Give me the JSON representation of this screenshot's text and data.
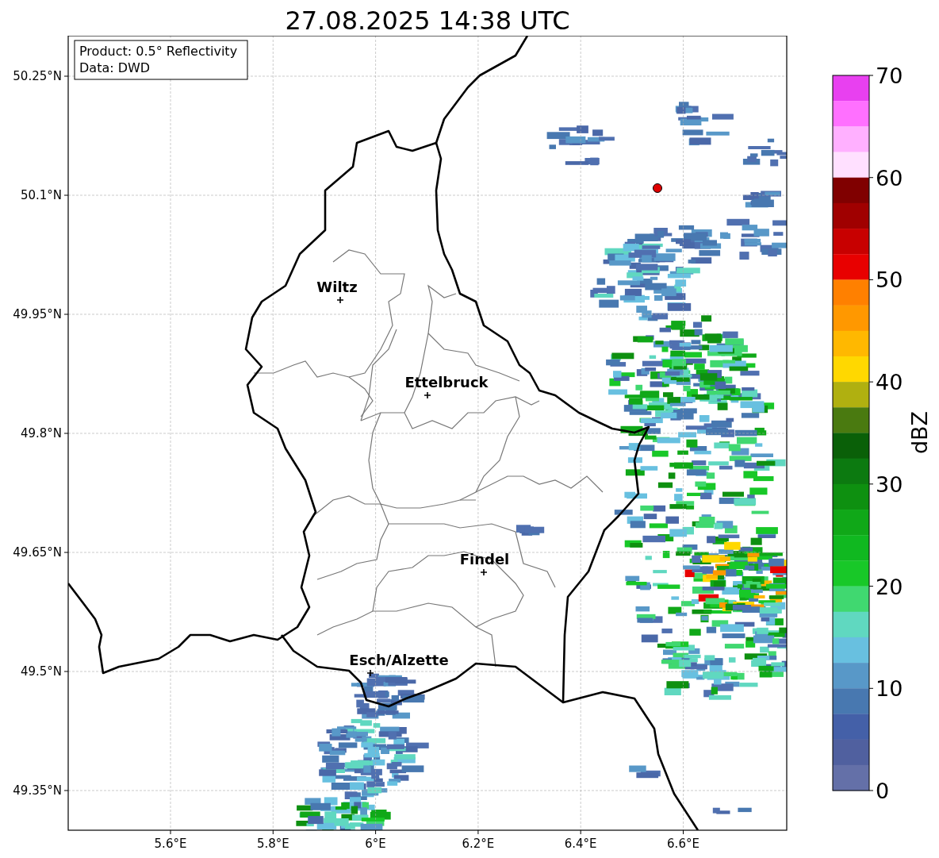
{
  "title": "27.08.2025 14:38 UTC",
  "info_box": [
    "Product: 0.5° Reflectivity",
    "Data: DWD"
  ],
  "map": {
    "x_ticks": [
      "5.6°E",
      "5.8°E",
      "6°E",
      "6.2°E",
      "6.4°E",
      "6.6°E"
    ],
    "y_ticks": [
      "50.25°N",
      "50.1°N",
      "49.95°N",
      "49.8°N",
      "49.65°N",
      "49.5°N",
      "49.35°N"
    ],
    "cities": [
      {
        "name": "Wiltz"
      },
      {
        "name": "Ettelbruck"
      },
      {
        "name": "Findel"
      },
      {
        "name": "Esch/Alzette"
      }
    ]
  },
  "colorbar": {
    "label": "dBZ",
    "ticks": [
      "70",
      "60",
      "50",
      "40",
      "30",
      "20",
      "10",
      "0"
    ],
    "segments": [
      {
        "color": "#e840f0"
      },
      {
        "color": "#ff70ff"
      },
      {
        "color": "#ffb0ff"
      },
      {
        "color": "#ffe0ff"
      },
      {
        "color": "#800000"
      },
      {
        "color": "#a00000"
      },
      {
        "color": "#c80000"
      },
      {
        "color": "#e80000"
      },
      {
        "color": "#ff8000"
      },
      {
        "color": "#ff9800"
      },
      {
        "color": "#ffb800"
      },
      {
        "color": "#ffd800"
      },
      {
        "color": "#b0b010"
      },
      {
        "color": "#4a7a10"
      },
      {
        "color": "#0a6008"
      },
      {
        "color": "#0c7a10"
      },
      {
        "color": "#0e9010"
      },
      {
        "color": "#10a818"
      },
      {
        "color": "#10b820"
      },
      {
        "color": "#18c828"
      },
      {
        "color": "#40d870"
      },
      {
        "color": "#60d8c0"
      },
      {
        "color": "#68c0e0"
      },
      {
        "color": "#5898c8"
      },
      {
        "color": "#4878b0"
      },
      {
        "color": "#4460a8"
      },
      {
        "color": "#50609f"
      },
      {
        "color": "#6470a8"
      }
    ]
  }
}
